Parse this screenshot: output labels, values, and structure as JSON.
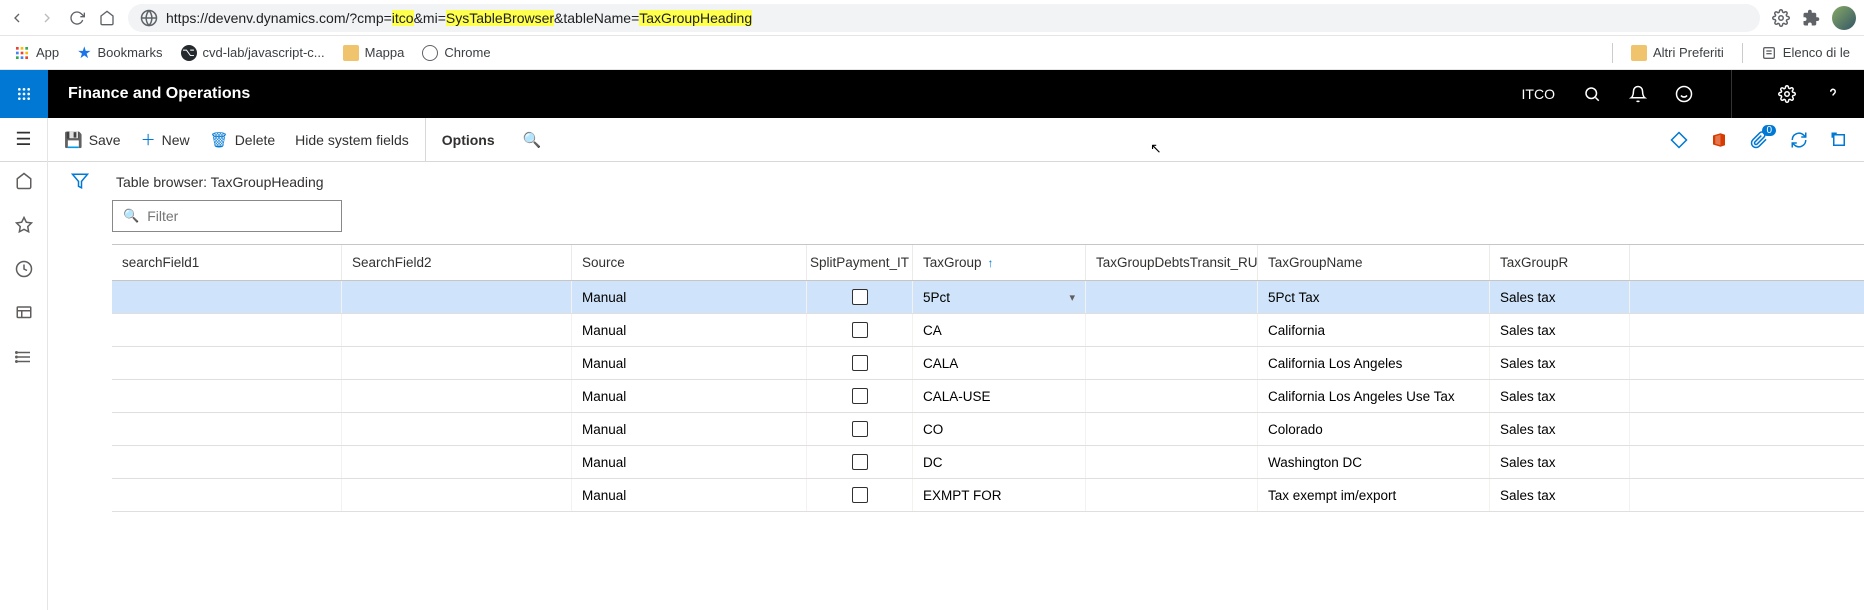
{
  "browser": {
    "url_parts": [
      {
        "t": "https://devenv.dynamics.com/?cmp=",
        "hl": false
      },
      {
        "t": "itco",
        "hl": true
      },
      {
        "t": "&mi=",
        "hl": false
      },
      {
        "t": "SysTableBrowser",
        "hl": true
      },
      {
        "t": "&tableName=",
        "hl": false
      },
      {
        "t": "TaxGroupHeading",
        "hl": true
      }
    ]
  },
  "bookmarks": {
    "apps": "App",
    "bookmarks": "Bookmarks",
    "gh": "cvd-lab/javascript-c...",
    "mappa": "Mappa",
    "chrome": "Chrome",
    "altri": "Altri Preferiti",
    "elenco": "Elenco di le"
  },
  "header": {
    "app_title": "Finance and Operations",
    "company": "ITCO"
  },
  "actionbar": {
    "save": "Save",
    "new": "New",
    "delete": "Delete",
    "hide_system_fields": "Hide system fields",
    "options": "Options",
    "attach_badge": "0"
  },
  "table": {
    "title": "Table browser: TaxGroupHeading",
    "filter_placeholder": "Filter",
    "columns": {
      "sf1": "searchField1",
      "sf2": "SearchField2",
      "src": "Source",
      "split": "SplitPayment_IT",
      "tg": "TaxGroup",
      "debts": "TaxGroupDebtsTransit_RU",
      "name": "TaxGroupName",
      "round": "TaxGroupR"
    },
    "rows": [
      {
        "src": "Manual",
        "split": false,
        "tg": "5Pct",
        "name": "5Pct Tax",
        "round": "Sales tax",
        "selected": true
      },
      {
        "src": "Manual",
        "split": false,
        "tg": "CA",
        "name": "California",
        "round": "Sales tax"
      },
      {
        "src": "Manual",
        "split": false,
        "tg": "CALA",
        "name": "California Los Angeles",
        "round": "Sales tax"
      },
      {
        "src": "Manual",
        "split": false,
        "tg": "CALA-USE",
        "name": "California  Los Angeles Use Tax",
        "round": "Sales tax"
      },
      {
        "src": "Manual",
        "split": false,
        "tg": "CO",
        "name": "Colorado",
        "round": "Sales tax"
      },
      {
        "src": "Manual",
        "split": false,
        "tg": "DC",
        "name": "Washington DC",
        "round": "Sales tax"
      },
      {
        "src": "Manual",
        "split": false,
        "tg": "EXMPT FOR",
        "name": "Tax exempt im/export",
        "round": "Sales tax"
      }
    ]
  }
}
